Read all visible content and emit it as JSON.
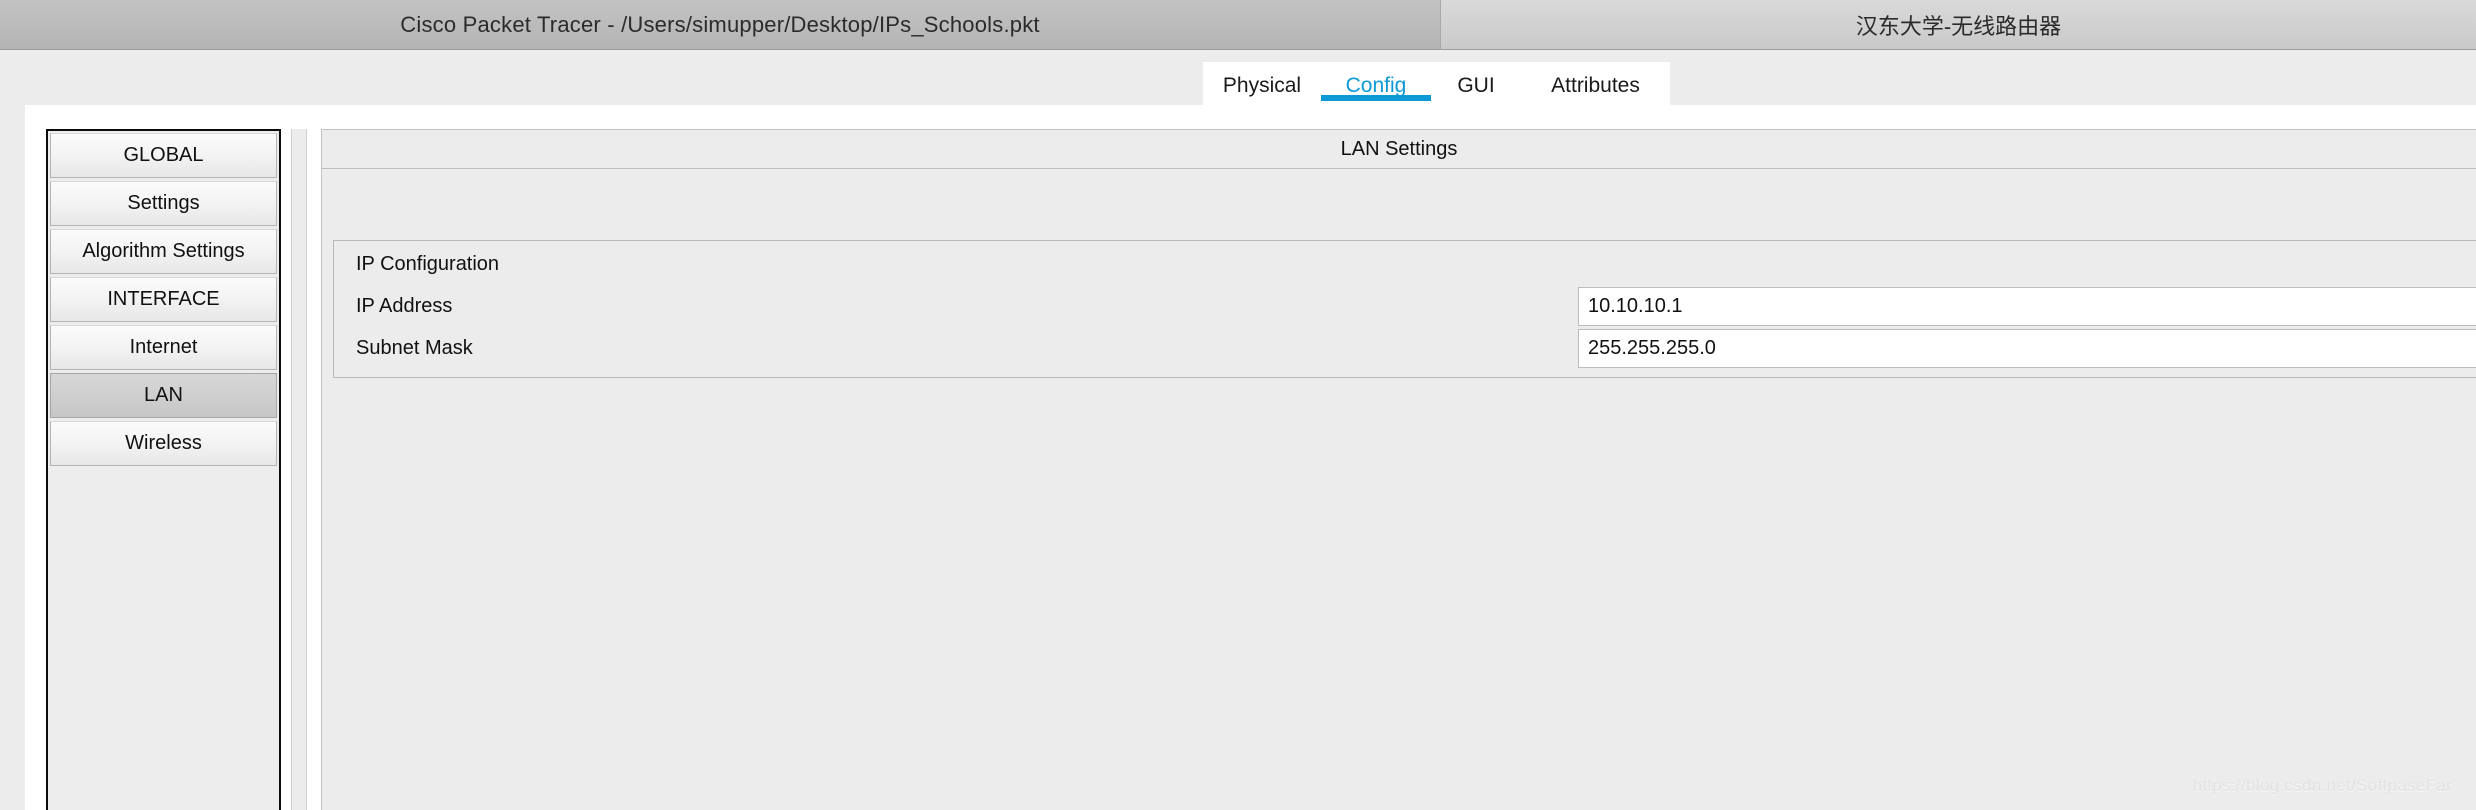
{
  "titlebar": {
    "app_title": "Cisco Packet Tracer - /Users/simupper/Desktop/IPs_Schools.pkt",
    "device_title": "汉东大学-无线路由器"
  },
  "tabs": [
    {
      "label": "Physical",
      "active": false
    },
    {
      "label": "Config",
      "active": true
    },
    {
      "label": "GUI",
      "active": false
    },
    {
      "label": "Attributes",
      "active": false
    }
  ],
  "sidebar": {
    "items": [
      {
        "label": "GLOBAL",
        "selected": false
      },
      {
        "label": "Settings",
        "selected": false
      },
      {
        "label": "Algorithm Settings",
        "selected": false
      },
      {
        "label": "INTERFACE",
        "selected": false
      },
      {
        "label": "Internet",
        "selected": false
      },
      {
        "label": "LAN",
        "selected": true
      },
      {
        "label": "Wireless",
        "selected": false
      }
    ]
  },
  "main": {
    "panel_title": "LAN Settings",
    "ip_configuration": {
      "group_label": "IP Configuration",
      "fields": [
        {
          "label": "IP Address",
          "value": "10.10.10.1"
        },
        {
          "label": "Subnet Mask",
          "value": "255.255.255.0"
        }
      ]
    }
  },
  "watermark": "https://blog.csdn.net/SoftpaseFar",
  "colors": {
    "accent": "#0c9ad7",
    "panel_bg": "#ececec",
    "titlebar_left": "#bcbcbc",
    "titlebar_right": "#d2d2d2"
  }
}
